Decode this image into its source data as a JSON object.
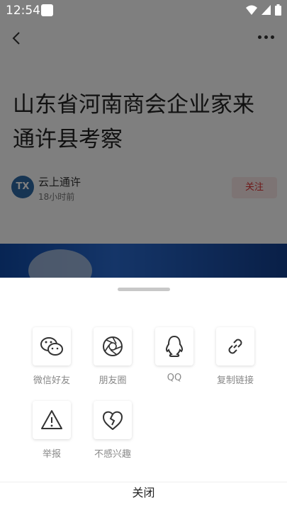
{
  "status_bar": {
    "time": "12:54"
  },
  "article": {
    "title": "山东省河南商会企业家来通许县考察",
    "author": {
      "avatar_text": "TX",
      "name": "云上通许",
      "time": "18小时前"
    },
    "follow_label": "关注"
  },
  "share_sheet": {
    "items": [
      {
        "label": "微信好友",
        "icon": "wechat-icon"
      },
      {
        "label": "朋友圈",
        "icon": "moments-icon"
      },
      {
        "label": "QQ",
        "icon": "qq-icon"
      },
      {
        "label": "复制链接",
        "icon": "link-icon"
      },
      {
        "label": "举报",
        "icon": "warning-icon"
      },
      {
        "label": "不感兴趣",
        "icon": "broken-heart-icon"
      }
    ],
    "close_label": "关闭"
  }
}
